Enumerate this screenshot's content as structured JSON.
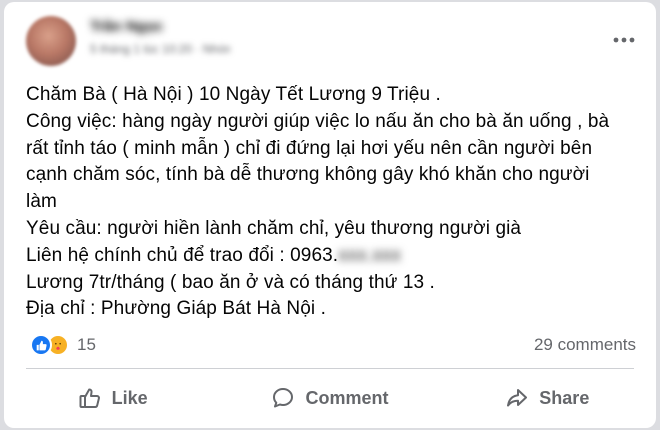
{
  "post": {
    "author_name": "Trần Ngọc",
    "meta": "5 tháng 1 lúc 10:20 · Nhóm",
    "lines": [
      "Chăm Bà ( Hà Nội ) 10 Ngày Tết Lương 9 Triệu .",
      "Công việc: hàng ngày người giúp việc lo nấu ăn cho  bà ăn uống , bà",
      "rất tỉnh táo ( minh mẫn ) chỉ đi đứng lại hơi yếu nên cần người bên",
      "cạnh chăm sóc, tính bà dễ thương không gây khó khăn cho người",
      "làm",
      "Yêu cầu: người hiền lành chăm chỉ, yêu thương người già"
    ],
    "contact_label": "Liên hệ chính chủ để trao đổi : 0963.",
    "contact_hidden": "xxx.xxx",
    "salary_line": "Lương 7tr/tháng ( bao ăn ở và có tháng thứ 13 .",
    "address_line": "Địa chỉ : Phường Giáp Bát Hà Nội ."
  },
  "reactions": {
    "types": [
      "like-icon",
      "care-icon"
    ],
    "count": "15",
    "comments": "29 comments"
  },
  "actions": {
    "like": "Like",
    "comment": "Comment",
    "share": "Share"
  },
  "colors": {
    "like_blue": "#1877f2",
    "care_yellow": "#f7b125",
    "secondary_text": "#65676b",
    "divider": "#ced0d4"
  }
}
